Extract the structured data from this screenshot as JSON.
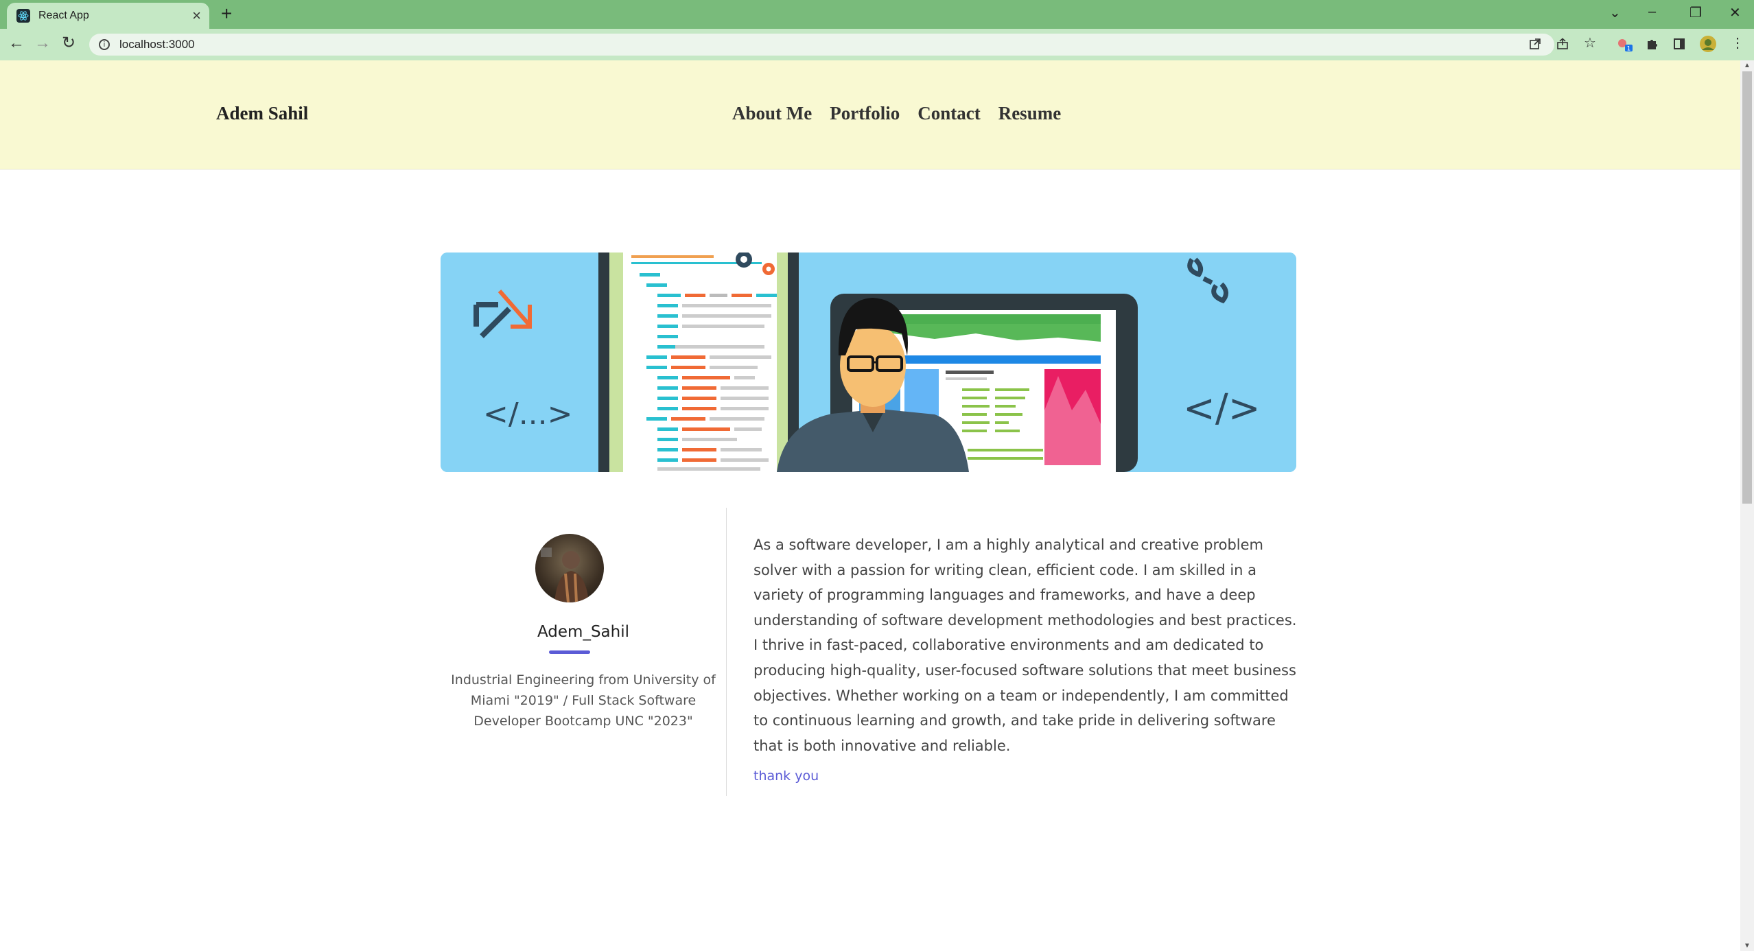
{
  "browser": {
    "tab_title": "React App",
    "url": "localhost:3000",
    "extension_badge": "1"
  },
  "site": {
    "brand": "Adem Sahil",
    "nav": [
      "About Me",
      "Portfolio",
      "Contact",
      "Resume"
    ]
  },
  "banner": {
    "code_tag_left": "</...>",
    "code_tag_right": "</>"
  },
  "profile": {
    "username": "Adem_Sahil",
    "bio": "Industrial Engineering from University of Miami \"2019\" / Full Stack Software Developer Bootcamp UNC \"2023\""
  },
  "about": {
    "paragraph": "As a software developer, I am a highly analytical and creative problem solver with a passion for writing clean, efficient code. I am skilled in a variety of programming languages and frameworks, and have a deep understanding of software development methodologies and best practices. I thrive in fast-paced, collaborative environments and am dedicated to producing high-quality, user-focused software solutions that meet business objectives. Whether working on a team or independently, I am committed to continuous learning and growth, and take pride in delivering software that is both innovative and reliable.",
    "link": "thank you"
  },
  "colors": {
    "tab_bar": "#79bb7b",
    "toolbar": "#c5e8c5",
    "header_bg": "#f9f9d2",
    "banner_bg": "#86d3f5",
    "accent": "#5b5bd6"
  }
}
